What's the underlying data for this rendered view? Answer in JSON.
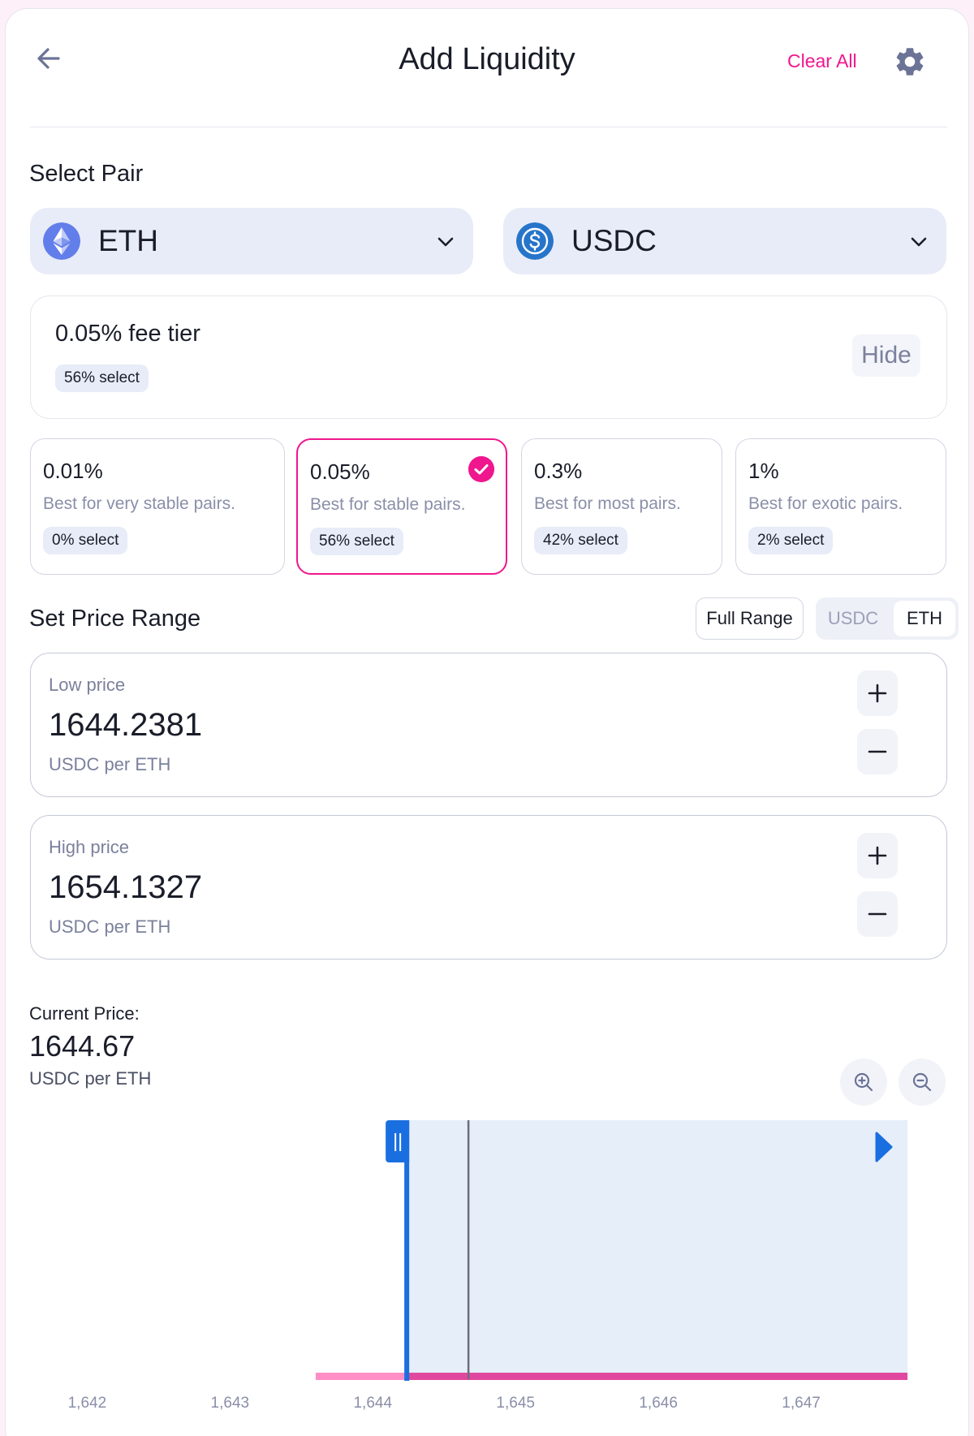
{
  "header": {
    "title": "Add Liquidity",
    "clear_all": "Clear All"
  },
  "select_pair": {
    "title": "Select Pair",
    "token_a": "ETH",
    "token_b": "USDC"
  },
  "fee_summary": {
    "label": "0.05% fee tier",
    "select_pct": "56% select",
    "hide_label": "Hide"
  },
  "fee_tiers": [
    {
      "pct": "0.01%",
      "desc": "Best for very stable pairs.",
      "select": "0% select",
      "selected": false
    },
    {
      "pct": "0.05%",
      "desc": "Best for stable pairs.",
      "select": "56% select",
      "selected": true
    },
    {
      "pct": "0.3%",
      "desc": "Best for most pairs.",
      "select": "42% select",
      "selected": false
    },
    {
      "pct": "1%",
      "desc": "Best for exotic pairs.",
      "select": "2% select",
      "selected": false
    }
  ],
  "price_range": {
    "title": "Set Price Range",
    "full_range": "Full Range",
    "toggle": [
      "USDC",
      "ETH"
    ],
    "toggle_selected": "ETH",
    "low": {
      "label": "Low price",
      "value": "1644.2381",
      "unit": "USDC per ETH"
    },
    "high": {
      "label": "High price",
      "value": "1654.1327",
      "unit": "USDC per ETH"
    }
  },
  "current_price": {
    "label": "Current Price:",
    "value": "1644.67",
    "unit": "USDC per ETH"
  },
  "chart_data": {
    "type": "line",
    "x_ticks": [
      "1,642",
      "1,643",
      "1,644",
      "1,645",
      "1,646",
      "1,647"
    ],
    "xlim": [
      1641.6,
      1648.0
    ],
    "liquidity_start": 1643.6,
    "range_low": 1644.2381,
    "range_high": 1654.1327,
    "current_price": 1644.67
  },
  "colors": {
    "accent_pink": "#f0168e",
    "brand_blue": "#1a6fe0",
    "range_fill": "#e6eef9",
    "liquidity_light": "#ff8ec6",
    "liquidity_dark": "#e0489f"
  },
  "icons": {
    "back": "arrow-left-icon",
    "settings": "gear-icon",
    "token_a": "ethereum-icon",
    "token_b": "usdc-icon",
    "zoom_in": "zoom-in-icon",
    "zoom_out": "zoom-out-icon"
  }
}
